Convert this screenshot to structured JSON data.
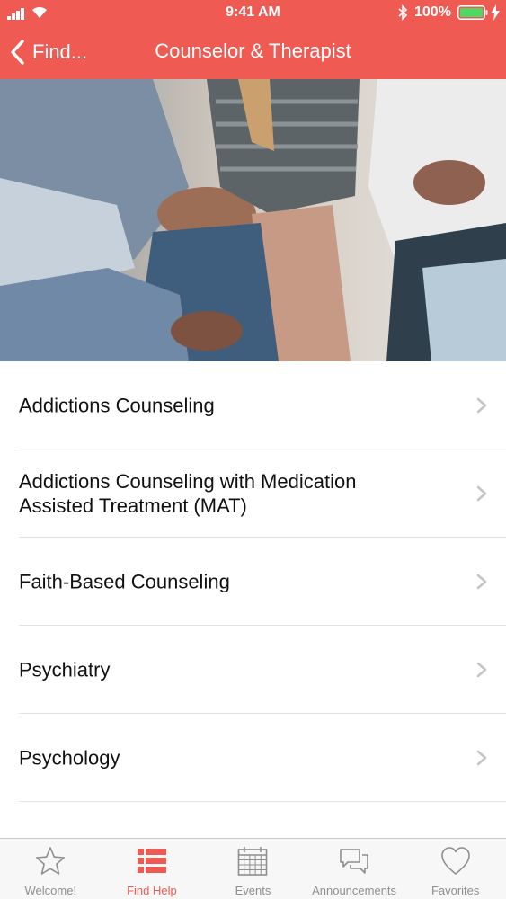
{
  "status_bar": {
    "time": "9:41 AM",
    "battery_percent": "100%"
  },
  "nav": {
    "back_label": "Find...",
    "title": "Counselor & Therapist"
  },
  "list": {
    "items": [
      {
        "label": "Addictions Counseling"
      },
      {
        "label": "Addictions Counseling with Medication Assisted Treatment (MAT)"
      },
      {
        "label": "Faith-Based Counseling"
      },
      {
        "label": "Psychiatry"
      },
      {
        "label": "Psychology"
      }
    ]
  },
  "tabbar": {
    "tabs": [
      {
        "label": "Welcome!",
        "icon": "star-icon",
        "active": false
      },
      {
        "label": "Find Help",
        "icon": "list-icon",
        "active": true
      },
      {
        "label": "Events",
        "icon": "calendar-icon",
        "active": false
      },
      {
        "label": "Announcements",
        "icon": "chat-bubbles-icon",
        "active": false
      },
      {
        "label": "Favorites",
        "icon": "heart-icon",
        "active": false
      }
    ]
  },
  "colors": {
    "accent": "#ef5a53",
    "tab_inactive": "#8e8e8e",
    "battery": "#4cd964"
  }
}
